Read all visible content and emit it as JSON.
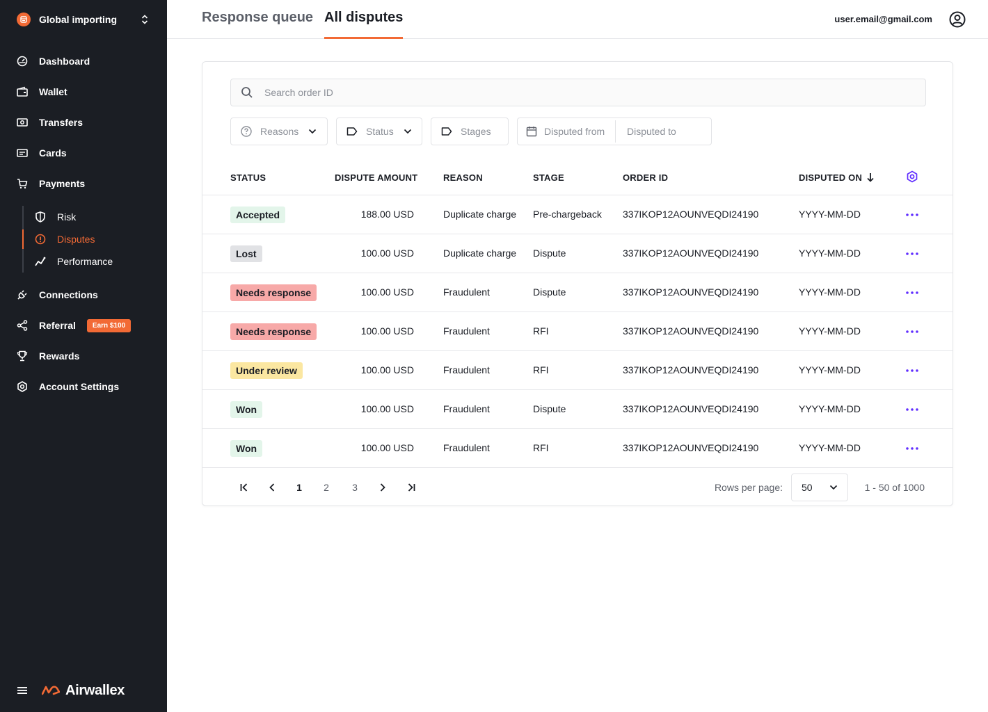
{
  "sidebar": {
    "workspace": "Global importing",
    "nav": [
      {
        "label": "Dashboard",
        "icon": "dashboard-icon"
      },
      {
        "label": "Wallet",
        "icon": "wallet-icon"
      },
      {
        "label": "Transfers",
        "icon": "transfers-icon"
      },
      {
        "label": "Cards",
        "icon": "cards-icon"
      },
      {
        "label": "Payments",
        "icon": "cart-icon"
      }
    ],
    "subnav": [
      {
        "label": "Risk",
        "icon": "shield-icon"
      },
      {
        "label": "Disputes",
        "icon": "alert-circle-icon",
        "active": true
      },
      {
        "label": "Performance",
        "icon": "trend-icon"
      }
    ],
    "nav2": [
      {
        "label": "Connections",
        "icon": "plug-icon"
      },
      {
        "label": "Referral",
        "icon": "share-icon",
        "badge": "Earn $100"
      },
      {
        "label": "Rewards",
        "icon": "trophy-icon"
      },
      {
        "label": "Account Settings",
        "icon": "gear-icon"
      }
    ],
    "brand": "Airwallex"
  },
  "header": {
    "tabs": [
      {
        "label": "Response queue",
        "active": false
      },
      {
        "label": "All disputes",
        "active": true
      }
    ],
    "user_email": "user.email@gmail.com"
  },
  "filters": {
    "search_placeholder": "Search order ID",
    "reasons": "Reasons",
    "status": "Status",
    "stages": "Stages",
    "disputed_from": "Disputed from",
    "disputed_to": "Disputed to"
  },
  "table": {
    "columns": [
      "STATUS",
      "DISPUTE AMOUNT",
      "REASON",
      "STAGE",
      "ORDER ID",
      "DISPUTED ON"
    ],
    "rows": [
      {
        "status": "Accepted",
        "amount": "188.00 USD",
        "reason": "Duplicate charge",
        "stage": "Pre-chargeback",
        "order_id": "337IKOP12AOUNVEQDI24190",
        "date": "YYYY-MM-DD"
      },
      {
        "status": "Lost",
        "amount": "100.00 USD",
        "reason": "Duplicate charge",
        "stage": "Dispute",
        "order_id": "337IKOP12AOUNVEQDI24190",
        "date": "YYYY-MM-DD"
      },
      {
        "status": "Needs response",
        "amount": "100.00 USD",
        "reason": "Fraudulent",
        "stage": "Dispute",
        "order_id": "337IKOP12AOUNVEQDI24190",
        "date": "YYYY-MM-DD"
      },
      {
        "status": "Needs response",
        "amount": "100.00 USD",
        "reason": "Fraudulent",
        "stage": "RFI",
        "order_id": "337IKOP12AOUNVEQDI24190",
        "date": "YYYY-MM-DD"
      },
      {
        "status": "Under review",
        "amount": "100.00 USD",
        "reason": "Fraudulent",
        "stage": "RFI",
        "order_id": "337IKOP12AOUNVEQDI24190",
        "date": "YYYY-MM-DD"
      },
      {
        "status": "Won",
        "amount": "100.00 USD",
        "reason": "Fraudulent",
        "stage": "Dispute",
        "order_id": "337IKOP12AOUNVEQDI24190",
        "date": "YYYY-MM-DD"
      },
      {
        "status": "Won",
        "amount": "100.00 USD",
        "reason": "Fraudulent",
        "stage": "RFI",
        "order_id": "337IKOP12AOUNVEQDI24190",
        "date": "YYYY-MM-DD"
      }
    ]
  },
  "status_colors": {
    "Accepted": {
      "bg": "#e3f5ea",
      "fg": "#1a1d24"
    },
    "Lost": {
      "bg": "#e1e2e5",
      "fg": "#1a1d24"
    },
    "Needs response": {
      "bg": "#f7a9a8",
      "fg": "#1a1d24"
    },
    "Under review": {
      "bg": "#fbe7a1",
      "fg": "#1a1d24"
    },
    "Won": {
      "bg": "#e3f5ea",
      "fg": "#1a1d24"
    }
  },
  "pagination": {
    "pages": [
      "1",
      "2",
      "3"
    ],
    "current": "1",
    "rows_per_page_label": "Rows per page:",
    "rows_per_page": "50",
    "range": "1 - 50 of 1000"
  },
  "colors": {
    "accent": "#f26a35",
    "purple": "#612fff",
    "sidebar_bg": "#1b1e24"
  }
}
